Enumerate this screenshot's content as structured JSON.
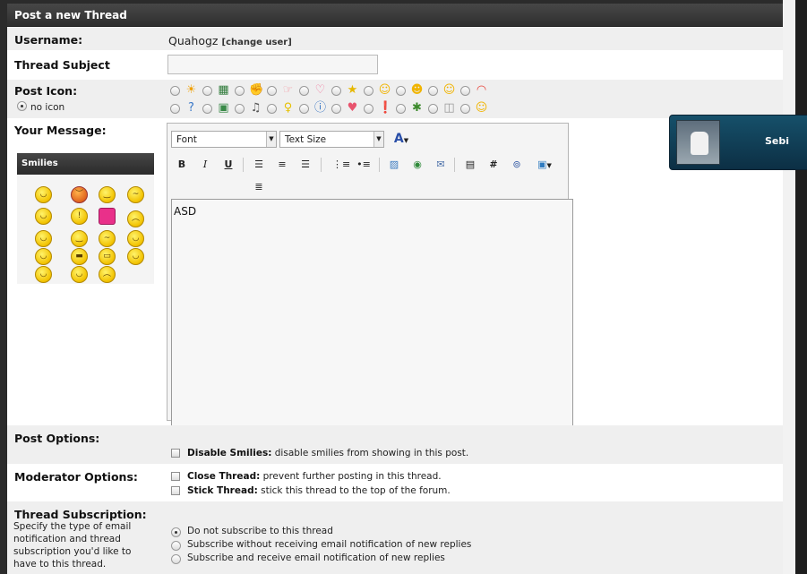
{
  "form": {
    "title": "Post a new Thread",
    "username_label": "Username:",
    "username_value": "Quahogz",
    "change_user_label": "[change user]",
    "subject_label": "Thread Subject",
    "subject_value": "",
    "post_icon_label": "Post Icon:",
    "no_icon_label": "no icon",
    "message_label": "Your Message:",
    "post_options_label": "Post Options:",
    "moderator_options_label": "Moderator Options:",
    "subscription_label": "Thread Subscription:",
    "subscription_desc": "Specify the type of email notification and thread subscription you'd like to have to this thread."
  },
  "post_icons": {
    "row1": [
      "sun-icon",
      "film-icon",
      "thumb-icon",
      "pointer-icon",
      "heart-bubble-icon",
      "star-icon",
      "smile-icon",
      "laugh-icon",
      "wink-icon",
      "rainbow-icon"
    ],
    "row2": [
      "question-icon",
      "picture-icon",
      "music-icon",
      "bulb-icon",
      "info-icon",
      "heart-icon",
      "warning-icon",
      "bug-icon",
      "box-icon",
      "grin-icon"
    ]
  },
  "smilies": {
    "title": "Smilies",
    "items": [
      "headphones-smiley",
      "angry-smiley",
      "wink-smiley",
      "confused-smiley",
      "cool-smiley",
      "exclaim-smiley",
      "heart-smiley",
      "question-smiley",
      "idea-smiley",
      "shy-smiley",
      "hmm-smiley",
      "smile-smiley",
      "grin-smiley",
      "glasses-smiley",
      "big-grin-smiley",
      "tongue-smiley",
      "happy-smiley",
      "eek-smiley",
      "frown-smiley"
    ]
  },
  "editor": {
    "font_label": "Font",
    "size_label": "Text Size",
    "message_text": "ASD"
  },
  "options": {
    "disable_smilies_title": "Disable Smilies:",
    "disable_smilies_desc": "disable smilies from showing in this post.",
    "close_thread_title": "Close Thread:",
    "close_thread_desc": "prevent further posting in this thread.",
    "stick_thread_title": "Stick Thread:",
    "stick_thread_desc": "stick this thread to the top of the forum."
  },
  "subscription_options": [
    "Do not subscribe to this thread",
    "Subscribe without receiving email notification of new replies",
    "Subscribe and receive email notification of new replies"
  ],
  "chat": {
    "user_name": "Sebi"
  }
}
